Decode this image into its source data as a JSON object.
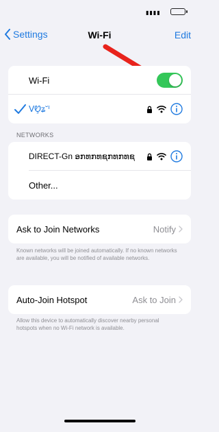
{
  "nav": {
    "back_label": "Settings",
    "title": "Wi-Fi",
    "edit_label": "Edit"
  },
  "wifi_toggle": {
    "label": "Wi-Fi",
    "state": "on"
  },
  "connected": {
    "network_name": "ᐯᏬ̧ʑ˘ᑊ"
  },
  "networks": {
    "header": "NETWORKS",
    "items": [
      {
        "name": "DIRECT-Gn ອກທກທຊກທກທຊ"
      }
    ],
    "other_label": "Other..."
  },
  "ask_to_join": {
    "label": "Ask to Join Networks",
    "value": "Notify",
    "footnote": "Known networks will be joined automatically. If no known networks are available, you will be notified of available networks."
  },
  "auto_join_hotspot": {
    "label": "Auto-Join Hotspot",
    "value": "Ask to Join",
    "footnote": "Allow this device to automatically discover nearby personal hotspots when no Wi-Fi network is available."
  },
  "colors": {
    "accent": "#1f7ae0",
    "toggle_on": "#34c759",
    "arrow": "#e8231c",
    "background": "#f2f2f7"
  }
}
